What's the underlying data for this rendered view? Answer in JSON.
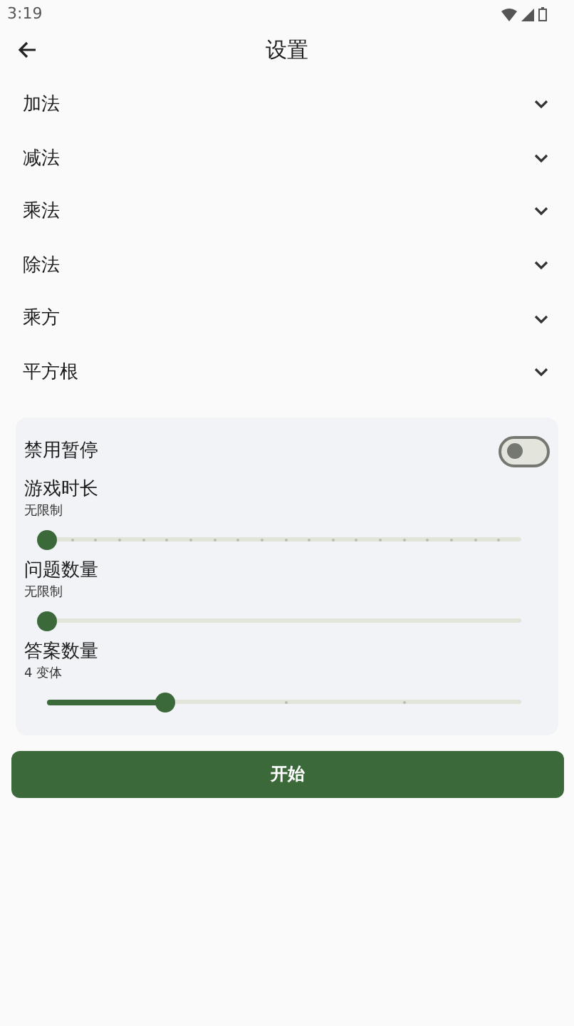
{
  "status_bar": {
    "time": "3:19"
  },
  "app_bar": {
    "title": "设置"
  },
  "sections": [
    {
      "label": "加法",
      "expanded": false
    },
    {
      "label": "减法",
      "expanded": false
    },
    {
      "label": "乘法",
      "expanded": false
    },
    {
      "label": "除法",
      "expanded": false
    },
    {
      "label": "乘方",
      "expanded": false
    },
    {
      "label": "平方根",
      "expanded": false
    }
  ],
  "options": {
    "toggle": {
      "label": "禁用暂停",
      "on": false
    },
    "sliders": [
      {
        "label": "游戏时长",
        "reading": "无限制",
        "kind": "fine",
        "level": 0
      },
      {
        "label": "问题数量",
        "reading": "无限制",
        "kind": "continuous",
        "level": 0
      },
      {
        "label": "答案数量",
        "reading": "4 变体",
        "kind": "coarse",
        "level": 0.25
      }
    ]
  },
  "start_button": "开始"
}
